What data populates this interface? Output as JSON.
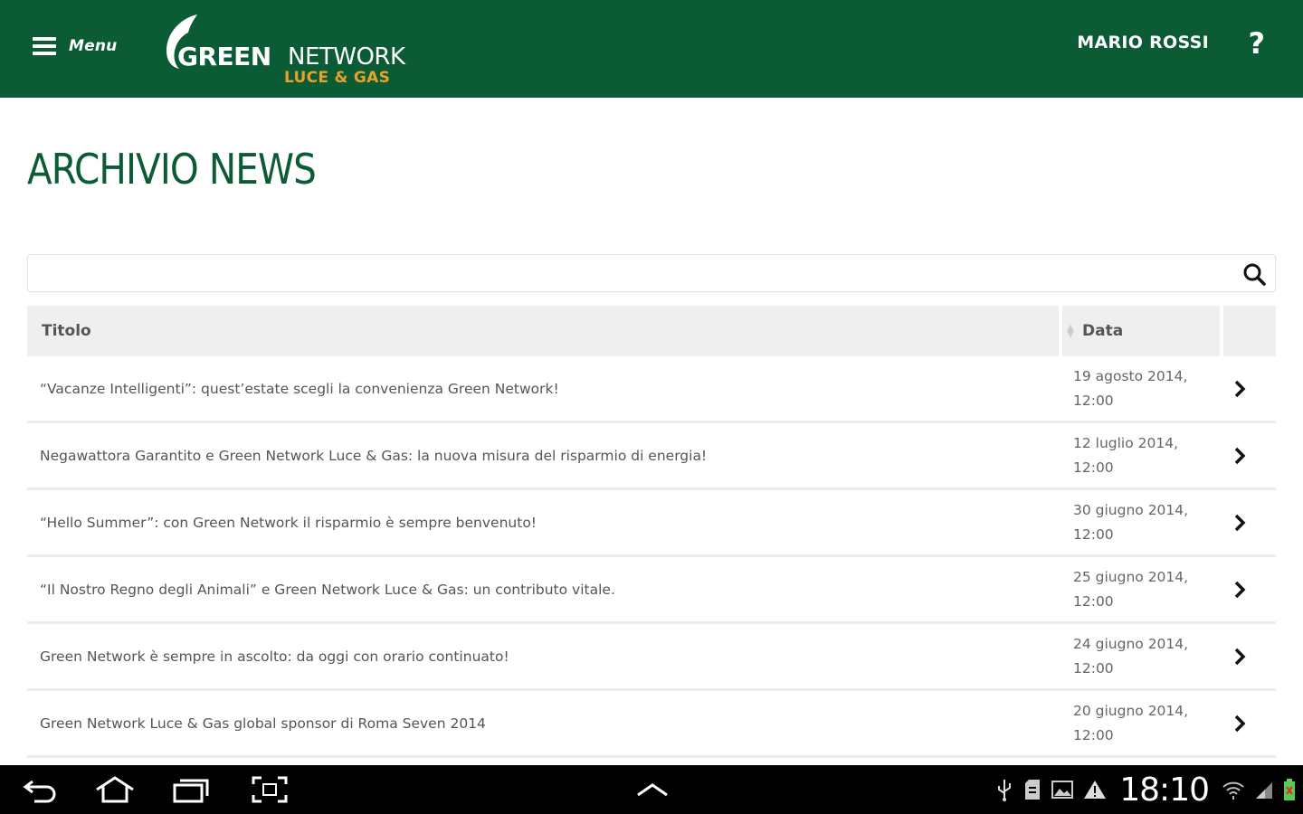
{
  "header": {
    "menu_label": "Menu",
    "brand": {
      "green": "GREEN",
      "network": "NETWORK",
      "tagline": "LUCE & GAS"
    },
    "user_name": "MARIO ROSSI",
    "help_label": "?"
  },
  "page": {
    "title": "ARCHIVIO NEWS"
  },
  "search": {
    "value": "",
    "placeholder": ""
  },
  "table": {
    "columns": {
      "title": "Titolo",
      "date": "Data"
    },
    "rows": [
      {
        "title": "“Vacanze Intelligenti”: quest’estate scegli la convenienza Green Network!",
        "date_day": "19 agosto 2014,",
        "date_time": "12:00"
      },
      {
        "title": "Negawattora Garantito e Green Network Luce & Gas: la nuova misura del risparmio di energia!",
        "date_day": "12 luglio 2014,",
        "date_time": "12:00"
      },
      {
        "title": "“Hello Summer”: con Green Network il risparmio è sempre benvenuto!",
        "date_day": "30 giugno 2014,",
        "date_time": "12:00"
      },
      {
        "title": "“Il Nostro Regno degli Animali” e Green Network Luce & Gas: un contributo vitale.",
        "date_day": "25 giugno 2014,",
        "date_time": "12:00"
      },
      {
        "title": "Green Network è sempre in ascolto: da oggi con orario continuato!",
        "date_day": "24 giugno 2014,",
        "date_time": "12:00"
      },
      {
        "title": "Green Network Luce & Gas global sponsor di Roma Seven 2014",
        "date_day": "20 giugno 2014,",
        "date_time": "12:00"
      }
    ]
  },
  "system_bar": {
    "clock": "18:10",
    "nav_icons": [
      "back-icon",
      "home-icon",
      "recent-apps-icon",
      "screenshot-icon",
      "up-chevron-icon"
    ],
    "status_icons": [
      "usb-icon",
      "sd-card-icon",
      "gallery-icon",
      "warning-icon",
      "wifi-icon",
      "signal-icon",
      "battery-icon"
    ]
  },
  "colors": {
    "brand_green": "#0b5b34",
    "brand_orange": "#e8a227",
    "header_bg": "#efefef"
  }
}
